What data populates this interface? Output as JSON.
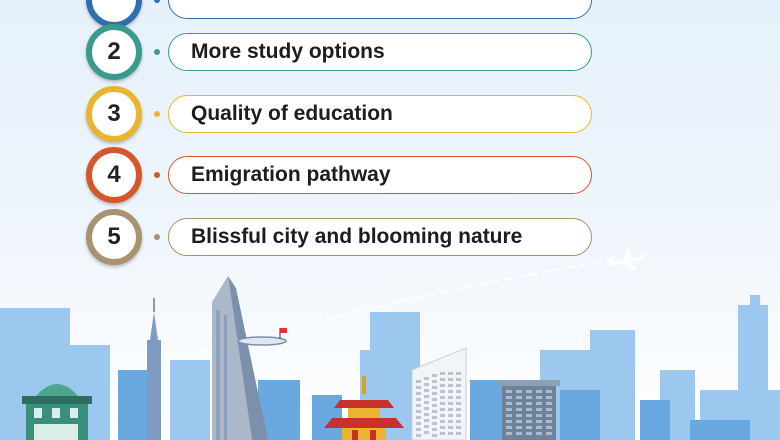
{
  "items": [
    {
      "number": "",
      "label": "",
      "color": "#2f6fb0"
    },
    {
      "number": "2",
      "label": "More study options",
      "color": "#3a9a8e"
    },
    {
      "number": "3",
      "label": "Quality of education",
      "color": "#e9b531"
    },
    {
      "number": "4",
      "label": "Emigration pathway",
      "color": "#d4562b"
    },
    {
      "number": "5",
      "label": "Blissful city and blooming nature",
      "color": "#a89270"
    }
  ],
  "colors": {
    "sky_light": "#e6f1fb",
    "building_blue": "#6aa9df",
    "building_light": "#9cc8ef",
    "pagoda_red": "#c8322a",
    "tower_gray": "#9aaec4"
  },
  "icons": [
    "airplane-icon",
    "flag-icon"
  ]
}
